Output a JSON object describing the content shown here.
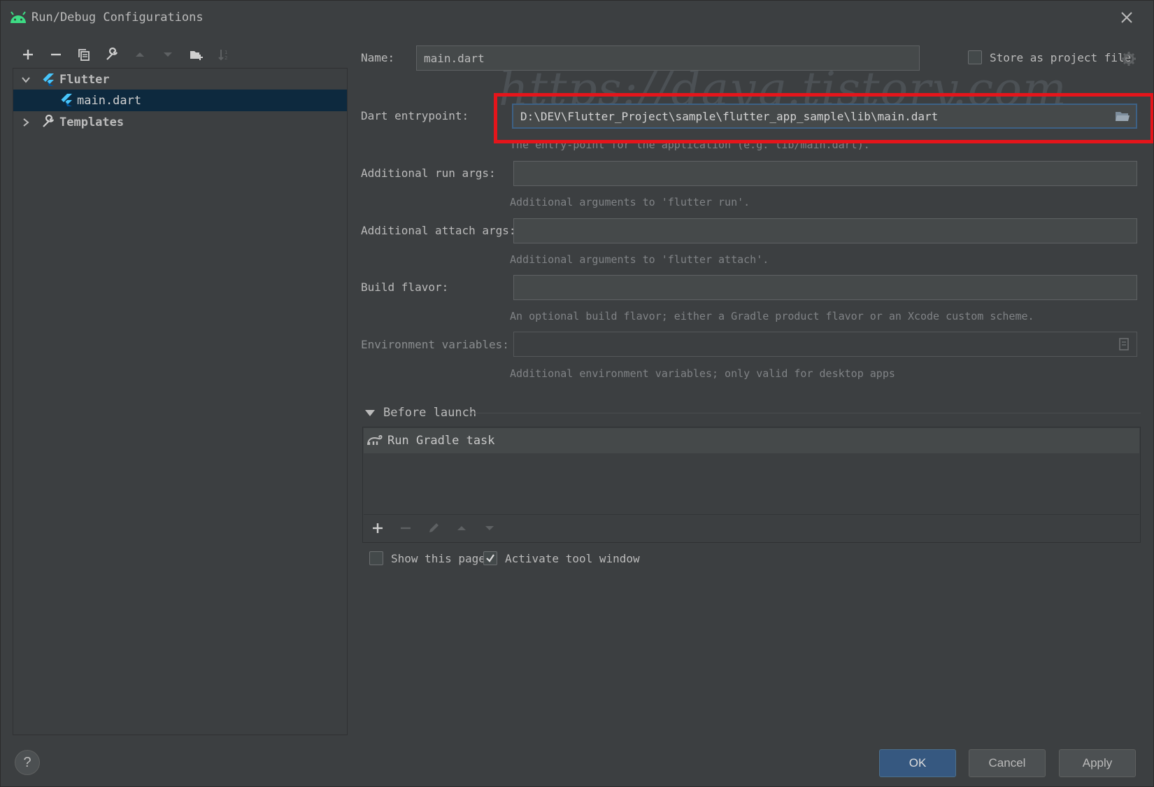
{
  "window": {
    "title": "Run/Debug Configurations",
    "title_icon": "android-icon"
  },
  "left_toolbar": {
    "buttons": [
      "add-icon",
      "remove-icon",
      "copy-icon",
      "wrench-icon",
      "move-up-icon",
      "move-down-icon",
      "new-folder-icon",
      "sort-icon"
    ]
  },
  "tree": {
    "flutter_group": "Flutter",
    "selected_item": "main.dart",
    "templates": "Templates"
  },
  "form": {
    "name_label": "Name:",
    "name_value": "main.dart",
    "store_label": "Store as project file",
    "store_checked": false,
    "entrypoint_label": "Dart entrypoint:",
    "entrypoint_value": "D:\\DEV\\Flutter_Project\\sample\\flutter_app_sample\\lib\\main.dart",
    "entrypoint_hint": "The entry-point for the application (e.g. lib/main.dart).",
    "run_args_label": "Additional run args:",
    "run_args_value": "",
    "run_args_hint": "Additional arguments to 'flutter run'.",
    "attach_args_label": "Additional attach args:",
    "attach_args_value": "",
    "attach_args_hint": "Additional arguments to 'flutter attach'.",
    "flavor_label": "Build flavor:",
    "flavor_value": "",
    "flavor_hint": "An optional build flavor; either a Gradle product flavor or an Xcode custom scheme.",
    "env_label": "Environment variables:",
    "env_value": "",
    "env_hint": "Additional environment variables; only valid for desktop apps"
  },
  "before_launch": {
    "title": "Before launch",
    "tasks": [
      "Run Gradle task"
    ],
    "show_page_label": "Show this page",
    "show_page_checked": false,
    "activate_label": "Activate tool window",
    "activate_checked": true
  },
  "watermark": "https://dayg.tistory.com",
  "buttons": {
    "ok": "OK",
    "cancel": "Cancel",
    "apply": "Apply",
    "help": "?"
  },
  "colors": {
    "accent": "#365880",
    "selection": "#0d293e",
    "highlight_box": "#e5151b",
    "flutter_blue": "#47c5fb"
  }
}
